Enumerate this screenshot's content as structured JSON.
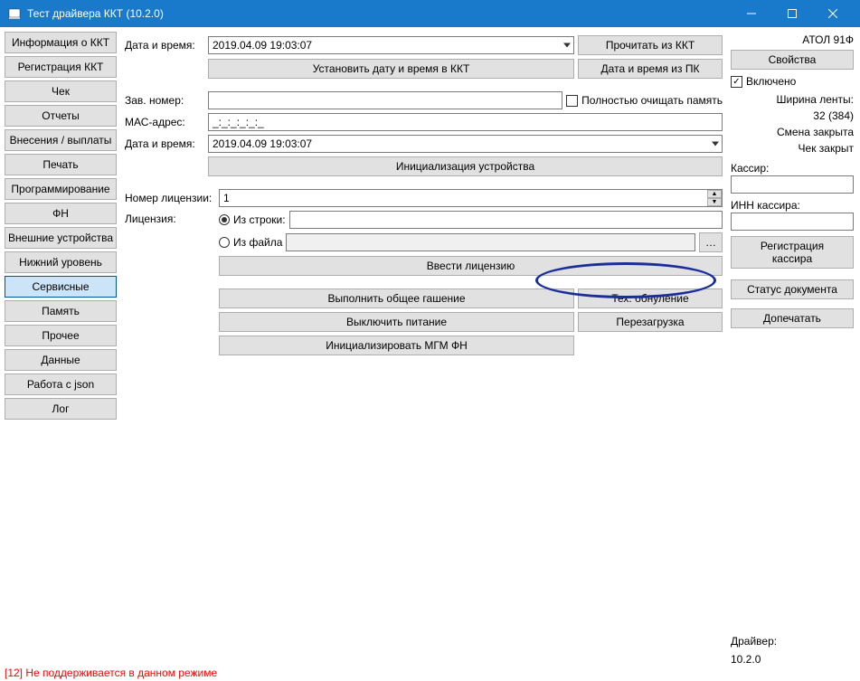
{
  "title": "Тест драйвера ККТ (10.2.0)",
  "nav": [
    "Информация о ККТ",
    "Регистрация ККТ",
    "Чек",
    "Отчеты",
    "Внесения / выплаты",
    "Печать",
    "Программирование",
    "ФН",
    "Внешние устройства",
    "Нижний уровень",
    "Сервисные",
    "Память",
    "Прочее",
    "Данные",
    "Работа с json",
    "Лог"
  ],
  "active_nav": "Сервисные",
  "labels": {
    "datetime1": "Дата и время:",
    "datetime1_val": "2019.04.09 19:03:07",
    "btn_read": "Прочитать из ККТ",
    "btn_setdt": "Установить дату и время в ККТ",
    "btn_dtpc": "Дата и время из ПК",
    "serial": "Зав. номер:",
    "mac": "МАС-адрес:",
    "mac_val": "_:_:_:_:_:_",
    "datetime2": "Дата и время:",
    "datetime2_val": "2019.04.09 19:03:07",
    "chk_clear": "Полностью очищать память",
    "btn_init": "Инициализация устройства",
    "lic_num": "Номер лицензии:",
    "lic_num_val": "1",
    "license": "Лицензия:",
    "r_string": "Из строки:",
    "r_file": "Из файла",
    "btn_lic": "Ввести лицензию",
    "btn_erase": "Выполнить общее гашение",
    "btn_techreset": "Тех. обнуление",
    "btn_poweroff": "Выключить питание",
    "btn_reboot": "Перезагрузка",
    "btn_initmgm": "Инициализировать МГМ ФН"
  },
  "right": {
    "model": "АТОЛ 91Ф",
    "btn_props": "Свойства",
    "chk_enabled": "Включено",
    "width_lbl": "Ширина ленты:",
    "width_val": "32 (384)",
    "shift": "Смена закрыта",
    "receipt": "Чек закрыт",
    "cashier": "Кассир:",
    "inn": "ИНН кассира:",
    "btn_reg": "Регистрация\nкассира",
    "btn_status": "Статус документа",
    "btn_print": "Допечатать",
    "drv_lbl": "Драйвер:",
    "drv_val": "10.2.0"
  },
  "status": "[12] Не поддерживается в данном режиме"
}
